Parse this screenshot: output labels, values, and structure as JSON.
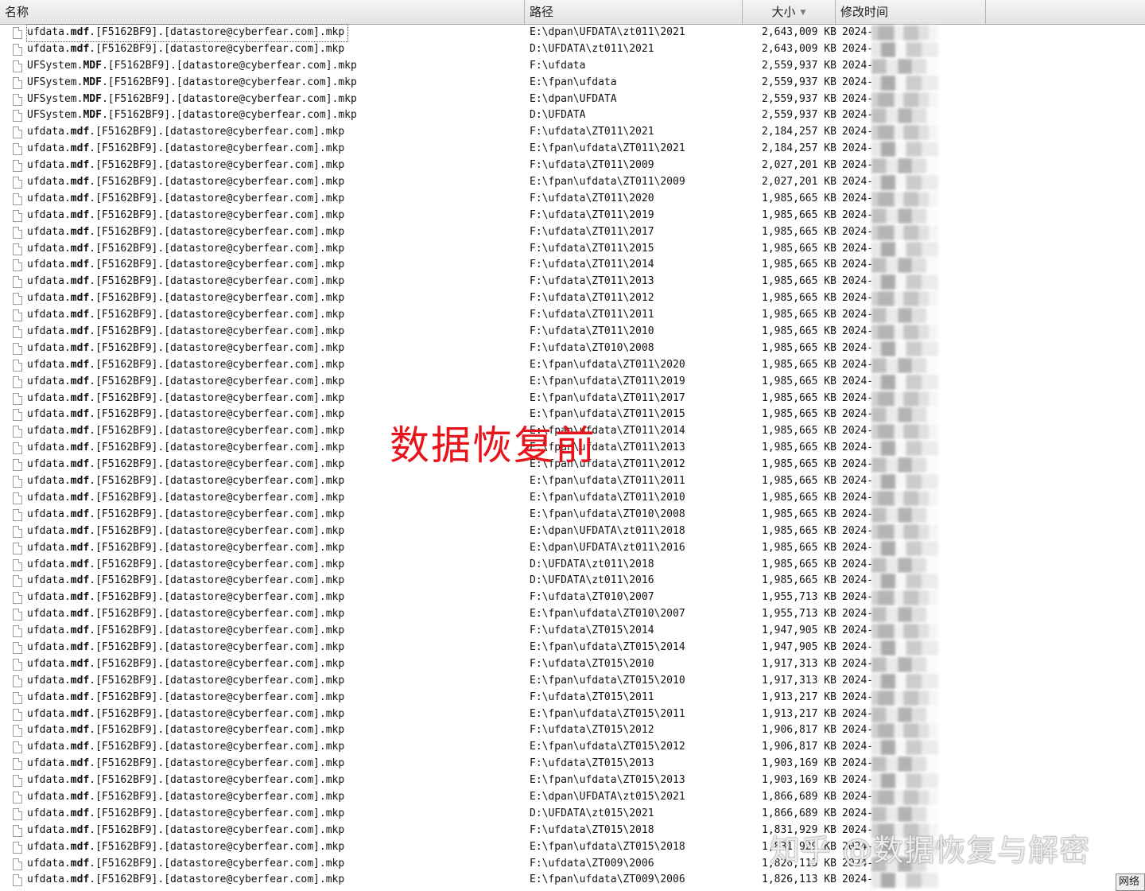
{
  "columns": {
    "name": "名称",
    "path": "路径",
    "size": "大小",
    "time": "修改时间"
  },
  "overlay_text": "数据恢复前",
  "watermark": "知乎 @数据恢复与解密",
  "corner_label": "网络",
  "rows": [
    {
      "n1": "ufdata.",
      "n2": "mdf",
      "n3": ".[F5162BF9].[datastore@cyberfear.com].mkp",
      "path": "E:\\dpan\\UFDATA\\zt011\\2021",
      "size": "2,643,009 KB",
      "time": "2024-"
    },
    {
      "n1": "ufdata.",
      "n2": "mdf",
      "n3": ".[F5162BF9].[datastore@cyberfear.com].mkp",
      "path": "D:\\UFDATA\\zt011\\2021",
      "size": "2,643,009 KB",
      "time": "2024-"
    },
    {
      "n1": "UFSystem.",
      "n2": "MDF",
      "n3": ".[F5162BF9].[datastore@cyberfear.com].mkp",
      "path": "F:\\ufdata",
      "size": "2,559,937 KB",
      "time": "2024-"
    },
    {
      "n1": "UFSystem.",
      "n2": "MDF",
      "n3": ".[F5162BF9].[datastore@cyberfear.com].mkp",
      "path": "E:\\fpan\\ufdata",
      "size": "2,559,937 KB",
      "time": "2024-"
    },
    {
      "n1": "UFSystem.",
      "n2": "MDF",
      "n3": ".[F5162BF9].[datastore@cyberfear.com].mkp",
      "path": "E:\\dpan\\UFDATA",
      "size": "2,559,937 KB",
      "time": "2024-"
    },
    {
      "n1": "UFSystem.",
      "n2": "MDF",
      "n3": ".[F5162BF9].[datastore@cyberfear.com].mkp",
      "path": "D:\\UFDATA",
      "size": "2,559,937 KB",
      "time": "2024-"
    },
    {
      "n1": "ufdata.",
      "n2": "mdf",
      "n3": ".[F5162BF9].[datastore@cyberfear.com].mkp",
      "path": "F:\\ufdata\\ZT011\\2021",
      "size": "2,184,257 KB",
      "time": "2024-"
    },
    {
      "n1": "ufdata.",
      "n2": "mdf",
      "n3": ".[F5162BF9].[datastore@cyberfear.com].mkp",
      "path": "E:\\fpan\\ufdata\\ZT011\\2021",
      "size": "2,184,257 KB",
      "time": "2024-"
    },
    {
      "n1": "ufdata.",
      "n2": "mdf",
      "n3": ".[F5162BF9].[datastore@cyberfear.com].mkp",
      "path": "F:\\ufdata\\ZT011\\2009",
      "size": "2,027,201 KB",
      "time": "2024-"
    },
    {
      "n1": "ufdata.",
      "n2": "mdf",
      "n3": ".[F5162BF9].[datastore@cyberfear.com].mkp",
      "path": "E:\\fpan\\ufdata\\ZT011\\2009",
      "size": "2,027,201 KB",
      "time": "2024-"
    },
    {
      "n1": "ufdata.",
      "n2": "mdf",
      "n3": ".[F5162BF9].[datastore@cyberfear.com].mkp",
      "path": "F:\\ufdata\\ZT011\\2020",
      "size": "1,985,665 KB",
      "time": "2024-"
    },
    {
      "n1": "ufdata.",
      "n2": "mdf",
      "n3": ".[F5162BF9].[datastore@cyberfear.com].mkp",
      "path": "F:\\ufdata\\ZT011\\2019",
      "size": "1,985,665 KB",
      "time": "2024-"
    },
    {
      "n1": "ufdata.",
      "n2": "mdf",
      "n3": ".[F5162BF9].[datastore@cyberfear.com].mkp",
      "path": "F:\\ufdata\\ZT011\\2017",
      "size": "1,985,665 KB",
      "time": "2024-"
    },
    {
      "n1": "ufdata.",
      "n2": "mdf",
      "n3": ".[F5162BF9].[datastore@cyberfear.com].mkp",
      "path": "F:\\ufdata\\ZT011\\2015",
      "size": "1,985,665 KB",
      "time": "2024-"
    },
    {
      "n1": "ufdata.",
      "n2": "mdf",
      "n3": ".[F5162BF9].[datastore@cyberfear.com].mkp",
      "path": "F:\\ufdata\\ZT011\\2014",
      "size": "1,985,665 KB",
      "time": "2024-"
    },
    {
      "n1": "ufdata.",
      "n2": "mdf",
      "n3": ".[F5162BF9].[datastore@cyberfear.com].mkp",
      "path": "F:\\ufdata\\ZT011\\2013",
      "size": "1,985,665 KB",
      "time": "2024-"
    },
    {
      "n1": "ufdata.",
      "n2": "mdf",
      "n3": ".[F5162BF9].[datastore@cyberfear.com].mkp",
      "path": "F:\\ufdata\\ZT011\\2012",
      "size": "1,985,665 KB",
      "time": "2024-"
    },
    {
      "n1": "ufdata.",
      "n2": "mdf",
      "n3": ".[F5162BF9].[datastore@cyberfear.com].mkp",
      "path": "F:\\ufdata\\ZT011\\2011",
      "size": "1,985,665 KB",
      "time": "2024-"
    },
    {
      "n1": "ufdata.",
      "n2": "mdf",
      "n3": ".[F5162BF9].[datastore@cyberfear.com].mkp",
      "path": "F:\\ufdata\\ZT011\\2010",
      "size": "1,985,665 KB",
      "time": "2024-"
    },
    {
      "n1": "ufdata.",
      "n2": "mdf",
      "n3": ".[F5162BF9].[datastore@cyberfear.com].mkp",
      "path": "F:\\ufdata\\ZT010\\2008",
      "size": "1,985,665 KB",
      "time": "2024-"
    },
    {
      "n1": "ufdata.",
      "n2": "mdf",
      "n3": ".[F5162BF9].[datastore@cyberfear.com].mkp",
      "path": "E:\\fpan\\ufdata\\ZT011\\2020",
      "size": "1,985,665 KB",
      "time": "2024-"
    },
    {
      "n1": "ufdata.",
      "n2": "mdf",
      "n3": ".[F5162BF9].[datastore@cyberfear.com].mkp",
      "path": "E:\\fpan\\ufdata\\ZT011\\2019",
      "size": "1,985,665 KB",
      "time": "2024-"
    },
    {
      "n1": "ufdata.",
      "n2": "mdf",
      "n3": ".[F5162BF9].[datastore@cyberfear.com].mkp",
      "path": "E:\\fpan\\ufdata\\ZT011\\2017",
      "size": "1,985,665 KB",
      "time": "2024-"
    },
    {
      "n1": "ufdata.",
      "n2": "mdf",
      "n3": ".[F5162BF9].[datastore@cyberfear.com].mkp",
      "path": "E:\\fpan\\ufdata\\ZT011\\2015",
      "size": "1,985,665 KB",
      "time": "2024-"
    },
    {
      "n1": "ufdata.",
      "n2": "mdf",
      "n3": ".[F5162BF9].[datastore@cyberfear.com].mkp",
      "path": "E:\\fpan\\ufdata\\ZT011\\2014",
      "size": "1,985,665 KB",
      "time": "2024-"
    },
    {
      "n1": "ufdata.",
      "n2": "mdf",
      "n3": ".[F5162BF9].[datastore@cyberfear.com].mkp",
      "path": "E:\\fpan\\ufdata\\ZT011\\2013",
      "size": "1,985,665 KB",
      "time": "2024-"
    },
    {
      "n1": "ufdata.",
      "n2": "mdf",
      "n3": ".[F5162BF9].[datastore@cyberfear.com].mkp",
      "path": "E:\\fpan\\ufdata\\ZT011\\2012",
      "size": "1,985,665 KB",
      "time": "2024-"
    },
    {
      "n1": "ufdata.",
      "n2": "mdf",
      "n3": ".[F5162BF9].[datastore@cyberfear.com].mkp",
      "path": "E:\\fpan\\ufdata\\ZT011\\2011",
      "size": "1,985,665 KB",
      "time": "2024-"
    },
    {
      "n1": "ufdata.",
      "n2": "mdf",
      "n3": ".[F5162BF9].[datastore@cyberfear.com].mkp",
      "path": "E:\\fpan\\ufdata\\ZT011\\2010",
      "size": "1,985,665 KB",
      "time": "2024-"
    },
    {
      "n1": "ufdata.",
      "n2": "mdf",
      "n3": ".[F5162BF9].[datastore@cyberfear.com].mkp",
      "path": "E:\\fpan\\ufdata\\ZT010\\2008",
      "size": "1,985,665 KB",
      "time": "2024-"
    },
    {
      "n1": "ufdata.",
      "n2": "mdf",
      "n3": ".[F5162BF9].[datastore@cyberfear.com].mkp",
      "path": "E:\\dpan\\UFDATA\\zt011\\2018",
      "size": "1,985,665 KB",
      "time": "2024-"
    },
    {
      "n1": "ufdata.",
      "n2": "mdf",
      "n3": ".[F5162BF9].[datastore@cyberfear.com].mkp",
      "path": "E:\\dpan\\UFDATA\\zt011\\2016",
      "size": "1,985,665 KB",
      "time": "2024-"
    },
    {
      "n1": "ufdata.",
      "n2": "mdf",
      "n3": ".[F5162BF9].[datastore@cyberfear.com].mkp",
      "path": "D:\\UFDATA\\zt011\\2018",
      "size": "1,985,665 KB",
      "time": "2024-"
    },
    {
      "n1": "ufdata.",
      "n2": "mdf",
      "n3": ".[F5162BF9].[datastore@cyberfear.com].mkp",
      "path": "D:\\UFDATA\\zt011\\2016",
      "size": "1,985,665 KB",
      "time": "2024-"
    },
    {
      "n1": "ufdata.",
      "n2": "mdf",
      "n3": ".[F5162BF9].[datastore@cyberfear.com].mkp",
      "path": "F:\\ufdata\\ZT010\\2007",
      "size": "1,955,713 KB",
      "time": "2024-"
    },
    {
      "n1": "ufdata.",
      "n2": "mdf",
      "n3": ".[F5162BF9].[datastore@cyberfear.com].mkp",
      "path": "E:\\fpan\\ufdata\\ZT010\\2007",
      "size": "1,955,713 KB",
      "time": "2024-"
    },
    {
      "n1": "ufdata.",
      "n2": "mdf",
      "n3": ".[F5162BF9].[datastore@cyberfear.com].mkp",
      "path": "F:\\ufdata\\ZT015\\2014",
      "size": "1,947,905 KB",
      "time": "2024-"
    },
    {
      "n1": "ufdata.",
      "n2": "mdf",
      "n3": ".[F5162BF9].[datastore@cyberfear.com].mkp",
      "path": "E:\\fpan\\ufdata\\ZT015\\2014",
      "size": "1,947,905 KB",
      "time": "2024-"
    },
    {
      "n1": "ufdata.",
      "n2": "mdf",
      "n3": ".[F5162BF9].[datastore@cyberfear.com].mkp",
      "path": "F:\\ufdata\\ZT015\\2010",
      "size": "1,917,313 KB",
      "time": "2024-"
    },
    {
      "n1": "ufdata.",
      "n2": "mdf",
      "n3": ".[F5162BF9].[datastore@cyberfear.com].mkp",
      "path": "E:\\fpan\\ufdata\\ZT015\\2010",
      "size": "1,917,313 KB",
      "time": "2024-"
    },
    {
      "n1": "ufdata.",
      "n2": "mdf",
      "n3": ".[F5162BF9].[datastore@cyberfear.com].mkp",
      "path": "F:\\ufdata\\ZT015\\2011",
      "size": "1,913,217 KB",
      "time": "2024-"
    },
    {
      "n1": "ufdata.",
      "n2": "mdf",
      "n3": ".[F5162BF9].[datastore@cyberfear.com].mkp",
      "path": "E:\\fpan\\ufdata\\ZT015\\2011",
      "size": "1,913,217 KB",
      "time": "2024-"
    },
    {
      "n1": "ufdata.",
      "n2": "mdf",
      "n3": ".[F5162BF9].[datastore@cyberfear.com].mkp",
      "path": "F:\\ufdata\\ZT015\\2012",
      "size": "1,906,817 KB",
      "time": "2024-"
    },
    {
      "n1": "ufdata.",
      "n2": "mdf",
      "n3": ".[F5162BF9].[datastore@cyberfear.com].mkp",
      "path": "E:\\fpan\\ufdata\\ZT015\\2012",
      "size": "1,906,817 KB",
      "time": "2024-"
    },
    {
      "n1": "ufdata.",
      "n2": "mdf",
      "n3": ".[F5162BF9].[datastore@cyberfear.com].mkp",
      "path": "F:\\ufdata\\ZT015\\2013",
      "size": "1,903,169 KB",
      "time": "2024-"
    },
    {
      "n1": "ufdata.",
      "n2": "mdf",
      "n3": ".[F5162BF9].[datastore@cyberfear.com].mkp",
      "path": "E:\\fpan\\ufdata\\ZT015\\2013",
      "size": "1,903,169 KB",
      "time": "2024-"
    },
    {
      "n1": "ufdata.",
      "n2": "mdf",
      "n3": ".[F5162BF9].[datastore@cyberfear.com].mkp",
      "path": "E:\\dpan\\UFDATA\\zt015\\2021",
      "size": "1,866,689 KB",
      "time": "2024-"
    },
    {
      "n1": "ufdata.",
      "n2": "mdf",
      "n3": ".[F5162BF9].[datastore@cyberfear.com].mkp",
      "path": "D:\\UFDATA\\zt015\\2021",
      "size": "1,866,689 KB",
      "time": "2024-"
    },
    {
      "n1": "ufdata.",
      "n2": "mdf",
      "n3": ".[F5162BF9].[datastore@cyberfear.com].mkp",
      "path": "F:\\ufdata\\ZT015\\2018",
      "size": "1,831,929 KB",
      "time": "2024-"
    },
    {
      "n1": "ufdata.",
      "n2": "mdf",
      "n3": ".[F5162BF9].[datastore@cyberfear.com].mkp",
      "path": "E:\\fpan\\ufdata\\ZT015\\2018",
      "size": "1,831,929 KB",
      "time": "2024-"
    },
    {
      "n1": "ufdata.",
      "n2": "mdf",
      "n3": ".[F5162BF9].[datastore@cyberfear.com].mkp",
      "path": "F:\\ufdata\\ZT009\\2006",
      "size": "1,826,113 KB",
      "time": "2024-"
    },
    {
      "n1": "ufdata.",
      "n2": "mdf",
      "n3": ".[F5162BF9].[datastore@cyberfear.com].mkp",
      "path": "E:\\fpan\\ufdata\\ZT009\\2006",
      "size": "1,826,113 KB",
      "time": "2024-"
    }
  ]
}
